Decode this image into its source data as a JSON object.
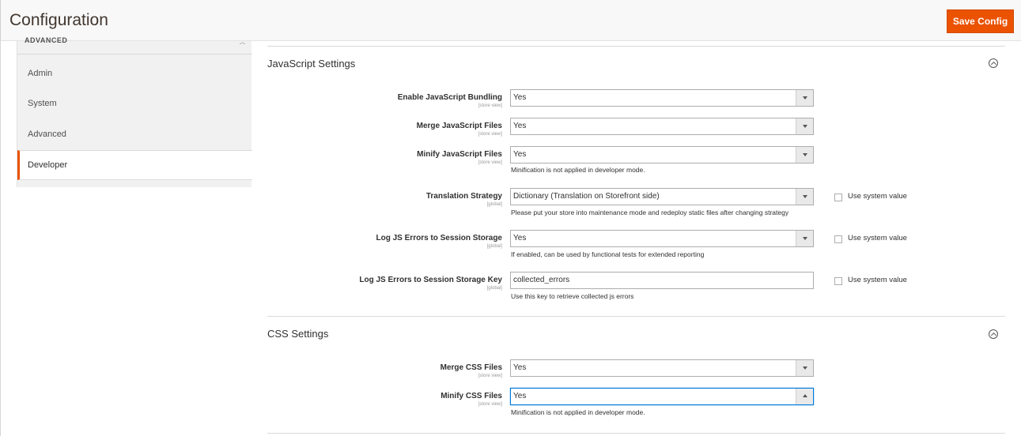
{
  "header": {
    "title": "Configuration",
    "save_label": "Save Config"
  },
  "sidebar": {
    "group_label_cut": "ADVANCED",
    "items": [
      {
        "label": "Admin"
      },
      {
        "label": "System"
      },
      {
        "label": "Advanced"
      },
      {
        "label": "Developer",
        "active": true
      }
    ]
  },
  "js_section": {
    "title": "JavaScript Settings",
    "fields": {
      "bundling": {
        "label": "Enable JavaScript Bundling",
        "scope": "[store view]",
        "value": "Yes"
      },
      "merge": {
        "label": "Merge JavaScript Files",
        "scope": "[store view]",
        "value": "Yes"
      },
      "minify": {
        "label": "Minify JavaScript Files",
        "scope": "[store view]",
        "value": "Yes",
        "note": "Minification is not applied in developer mode."
      },
      "translation": {
        "label": "Translation Strategy",
        "scope": "[global]",
        "value": "Dictionary (Translation on Storefront side)",
        "note": "Please put your store into maintenance mode and redeploy static files after changing strategy",
        "system_label": "Use system value"
      },
      "log_errors": {
        "label": "Log JS Errors to Session Storage",
        "scope": "[global]",
        "value": "Yes",
        "note": "If enabled, can be used by functional tests for extended reporting",
        "system_label": "Use system value"
      },
      "log_key": {
        "label": "Log JS Errors to Session Storage Key",
        "scope": "[global]",
        "value": "collected_errors",
        "note": "Use this key to retrieve collected js errors",
        "system_label": "Use system value"
      }
    }
  },
  "css_section": {
    "title": "CSS Settings",
    "fields": {
      "merge": {
        "label": "Merge CSS Files",
        "scope": "[store view]",
        "value": "Yes"
      },
      "minify": {
        "label": "Minify CSS Files",
        "scope": "[store view]",
        "value": "Yes",
        "note": "Minification is not applied in developer mode."
      }
    }
  },
  "colors": {
    "accent": "#eb5202",
    "focus": "#007bdb"
  },
  "icons": {
    "collapse": "chevron-up-circle-icon",
    "select_arrow": "caret-down-icon"
  }
}
